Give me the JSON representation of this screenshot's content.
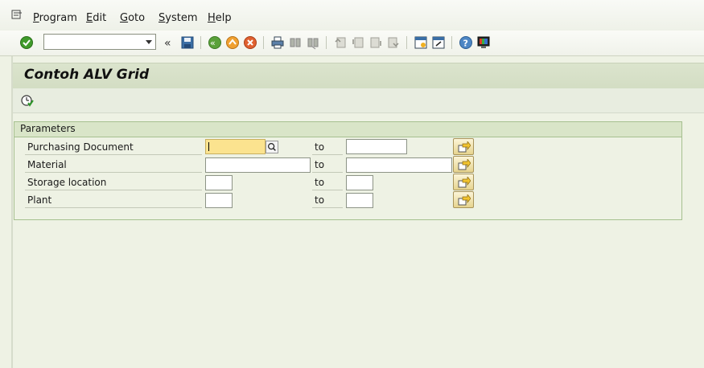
{
  "menu": {
    "items": [
      {
        "label": "Program"
      },
      {
        "label": "Edit"
      },
      {
        "label": "Goto"
      },
      {
        "label": "System"
      },
      {
        "label": "Help"
      }
    ]
  },
  "toolbar": {
    "command_field_value": "",
    "icons": [
      "enter-icon",
      "back-double-icon",
      "save-icon",
      "back-icon",
      "exit-icon",
      "cancel-icon",
      "print-icon",
      "find-icon",
      "find-next-icon",
      "first-page-icon",
      "previous-page-icon",
      "next-page-icon",
      "last-page-icon",
      "create-session-icon",
      "shortcut-icon",
      "help-icon",
      "customize-layout-icon"
    ]
  },
  "screen": {
    "title": "Contoh ALV Grid"
  },
  "parameters": {
    "group_title": "Parameters",
    "to_label": "to",
    "rows": [
      {
        "label": "Purchasing Document",
        "low": "",
        "high": ""
      },
      {
        "label": "Material",
        "low": "",
        "high": ""
      },
      {
        "label": "Storage location",
        "low": "",
        "high": ""
      },
      {
        "label": "Plant",
        "low": "",
        "high": ""
      }
    ]
  },
  "colors": {
    "background": "#eef2e4",
    "title_bar": "#d3ddc3",
    "group_header": "#d9e5c8",
    "active_input": "#fbe38f"
  }
}
